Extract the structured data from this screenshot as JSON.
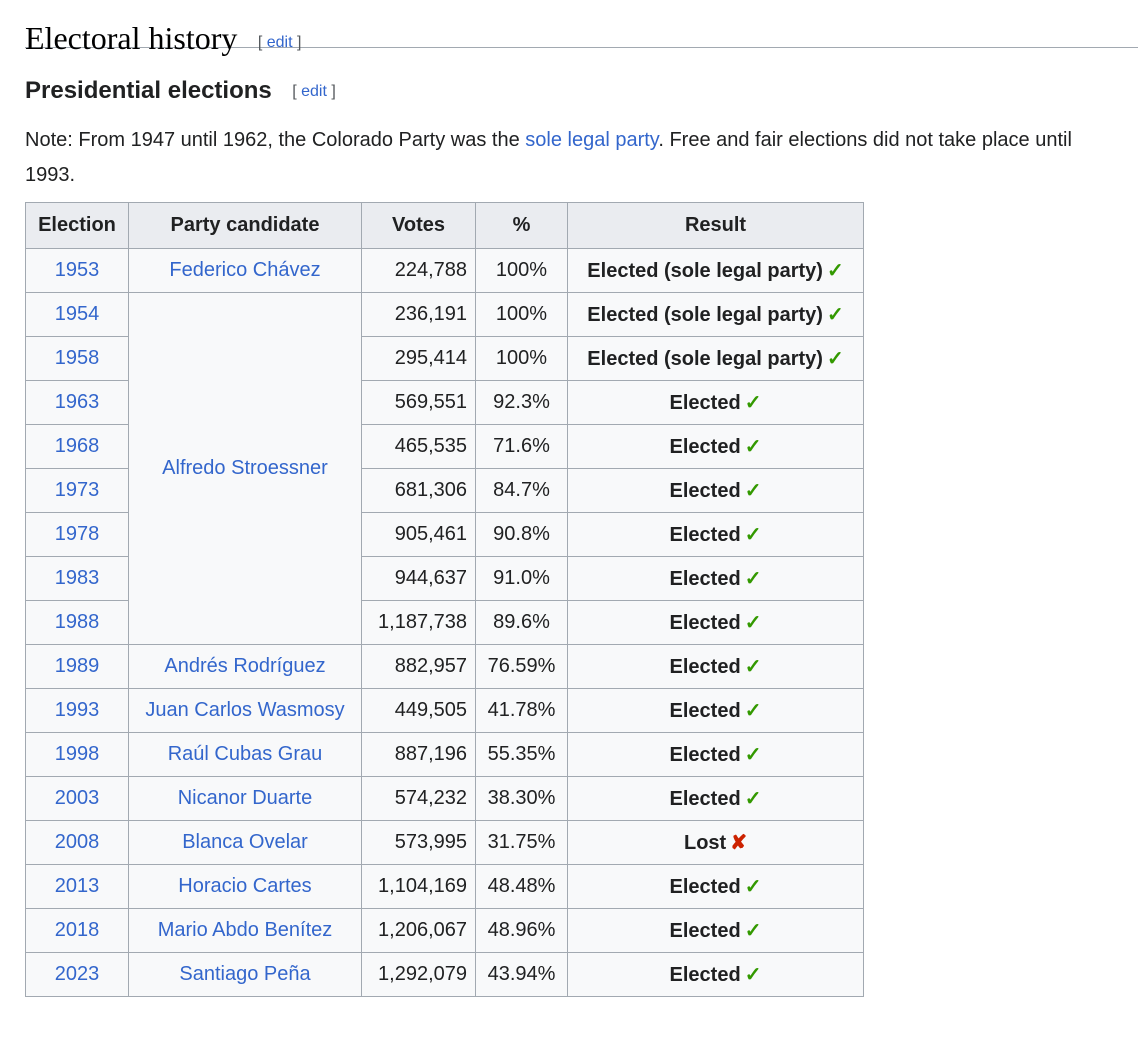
{
  "heading": {
    "title": "Electoral history",
    "edit_label": "edit",
    "open_bracket": "[",
    "close_bracket": "]"
  },
  "subheading": {
    "title": "Presidential elections",
    "edit_label": "edit",
    "open_bracket": "[",
    "close_bracket": "]"
  },
  "note": {
    "before": "Note: From 1947 until 1962, the Colorado Party was the ",
    "link": "sole legal party",
    "after": ". Free and fair elections did not take place until 1993."
  },
  "table": {
    "headers": [
      "Election",
      "Party candidate",
      "Votes",
      "%",
      "Result"
    ],
    "rows": [
      {
        "year": "1953",
        "candidate": "Federico Chávez",
        "votes": "224,788",
        "pct": "100%",
        "result": "Elected (sole legal party)",
        "mark": "✓",
        "won": true
      },
      {
        "year": "1954",
        "candidate": "Alfredo Stroessner",
        "votes": "236,191",
        "pct": "100%",
        "result": "Elected (sole legal party)",
        "mark": "✓",
        "won": true
      },
      {
        "year": "1958",
        "candidate": "",
        "votes": "295,414",
        "pct": "100%",
        "result": "Elected (sole legal party)",
        "mark": "✓",
        "won": true
      },
      {
        "year": "1963",
        "candidate": "",
        "votes": "569,551",
        "pct": "92.3%",
        "result": "Elected",
        "mark": "✓",
        "won": true
      },
      {
        "year": "1968",
        "candidate": "",
        "votes": "465,535",
        "pct": "71.6%",
        "result": "Elected",
        "mark": "✓",
        "won": true
      },
      {
        "year": "1973",
        "candidate": "",
        "votes": "681,306",
        "pct": "84.7%",
        "result": "Elected",
        "mark": "✓",
        "won": true
      },
      {
        "year": "1978",
        "candidate": "",
        "votes": "905,461",
        "pct": "90.8%",
        "result": "Elected",
        "mark": "✓",
        "won": true
      },
      {
        "year": "1983",
        "candidate": "",
        "votes": "944,637",
        "pct": "91.0%",
        "result": "Elected",
        "mark": "✓",
        "won": true
      },
      {
        "year": "1988",
        "candidate": "",
        "votes": "1,187,738",
        "pct": "89.6%",
        "result": "Elected",
        "mark": "✓",
        "won": true
      },
      {
        "year": "1989",
        "candidate": "Andrés Rodríguez",
        "votes": "882,957",
        "pct": "76.59%",
        "result": "Elected",
        "mark": "✓",
        "won": true
      },
      {
        "year": "1993",
        "candidate": "Juan Carlos Wasmosy",
        "votes": "449,505",
        "pct": "41.78%",
        "result": "Elected",
        "mark": "✓",
        "won": true
      },
      {
        "year": "1998",
        "candidate": "Raúl Cubas Grau",
        "votes": "887,196",
        "pct": "55.35%",
        "result": "Elected",
        "mark": "✓",
        "won": true
      },
      {
        "year": "2003",
        "candidate": "Nicanor Duarte",
        "votes": "574,232",
        "pct": "38.30%",
        "result": "Elected",
        "mark": "✓",
        "won": true
      },
      {
        "year": "2008",
        "candidate": "Blanca Ovelar",
        "votes": "573,995",
        "pct": "31.75%",
        "result": "Lost",
        "mark": "✘",
        "won": false
      },
      {
        "year": "2013",
        "candidate": "Horacio Cartes",
        "votes": "1,104,169",
        "pct": "48.48%",
        "result": "Elected",
        "mark": "✓",
        "won": true
      },
      {
        "year": "2018",
        "candidate": "Mario Abdo Benítez",
        "votes": "1,206,067",
        "pct": "48.96%",
        "result": "Elected",
        "mark": "✓",
        "won": true
      },
      {
        "year": "2023",
        "candidate": "Santiago Peña",
        "votes": "1,292,079",
        "pct": "43.94%",
        "result": "Elected",
        "mark": "✓",
        "won": true
      }
    ],
    "stroessner_rowspan": 8
  },
  "colors": {
    "link": "#3366cc",
    "check": "#339900",
    "cross": "#cc2200",
    "header_bg": "#eaecf0",
    "cell_bg": "#f8f9fa",
    "border": "#a2a9b1"
  }
}
